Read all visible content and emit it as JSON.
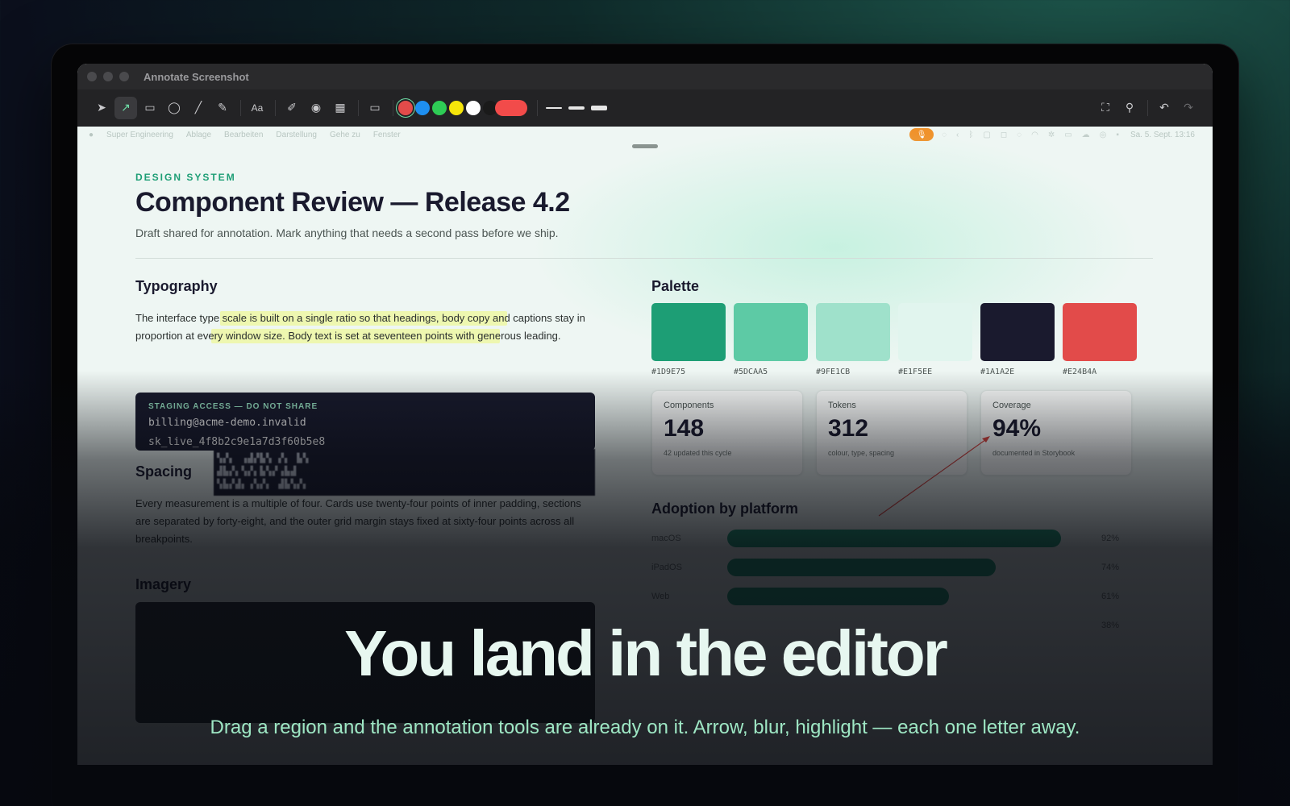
{
  "window": {
    "title": "Annotate Screenshot"
  },
  "toolbar": {
    "tools": [
      {
        "name": "select-tool",
        "glyph": "➤"
      },
      {
        "name": "arrow-tool",
        "glyph": "↗",
        "active": true
      },
      {
        "name": "rectangle-tool",
        "glyph": "▭"
      },
      {
        "name": "ellipse-tool",
        "glyph": "◯"
      },
      {
        "name": "line-tool",
        "glyph": "╱"
      },
      {
        "name": "freehand-tool",
        "glyph": "✎"
      },
      {
        "name": "text-tool",
        "glyph": "Aa"
      },
      {
        "name": "highlighter-tool",
        "glyph": "🖍"
      },
      {
        "name": "blur-tool",
        "glyph": "◉"
      },
      {
        "name": "pixelate-tool",
        "glyph": "▦"
      },
      {
        "name": "redact-tool",
        "glyph": "▬"
      }
    ],
    "colors": [
      "#E24B4A",
      "#1E8FF0",
      "#2ECC55",
      "#F5E50A",
      "#FFFFFF",
      "#1A1A1A"
    ],
    "selected_color": "#E24B4A",
    "active_color_pill": "#F24B4A"
  },
  "menubar": {
    "items": [
      "Super Engineering",
      "Ablage",
      "Bearbeiten",
      "Darstellung",
      "Gehe zu",
      "Fenster"
    ],
    "clock": "Sa. 5. Sept. 13:16"
  },
  "doc": {
    "eyebrow": "DESIGN SYSTEM",
    "title": "Component Review — Release 4.2",
    "subtitle": "Draft shared for annotation. Mark anything that needs a second pass before we ship.",
    "typography": {
      "heading": "Typography",
      "line1": "The interface type scale is built on a single ratio so that headings, body copy and captions stay in",
      "line2": "proportion at every window size. Body text is set at seventeen points with generous leading."
    },
    "secret": {
      "label": "STAGING ACCESS — DO NOT SHARE",
      "email": "billing@acme-demo.invalid",
      "key": "sk_live_4f8b2c9e1a7d3f60b5e8"
    },
    "pixelated_lines": [
      "▚▞▖ ▗▟▞▙▚ ▞▖ ▙▚",
      "▟▙▞▖▚▞▖▙▚▞▗▙▟",
      "▚▙▞▟▖▗▚▞▖ ▟▙▚▞▖"
    ],
    "spacing": {
      "heading": "Spacing",
      "line1": "Every measurement is a multiple of four. Cards use twenty-four points of inner padding, sections",
      "line2": "are separated by forty-eight, and the outer grid margin stays fixed at sixty-four points across all",
      "line3": "breakpoints."
    },
    "imagery": {
      "heading": "Imagery"
    },
    "palette": {
      "heading": "Palette",
      "swatches": [
        {
          "hex": "#1D9E75"
        },
        {
          "hex": "#5DCAA5"
        },
        {
          "hex": "#9FE1CB"
        },
        {
          "hex": "#E1F5EE"
        },
        {
          "hex": "#1A1A2E"
        },
        {
          "hex": "#E24B4A"
        }
      ]
    },
    "stats": [
      {
        "label": "Components",
        "value": "148",
        "note": "42 updated this cycle"
      },
      {
        "label": "Tokens",
        "value": "312",
        "note": "colour, type, spacing"
      },
      {
        "label": "Coverage",
        "value": "94%",
        "note": "documented in Storybook"
      }
    ],
    "adoption": {
      "heading": "Adoption by platform",
      "rows": [
        {
          "platform": "macOS",
          "value": 92,
          "label": "92%"
        },
        {
          "platform": "iPadOS",
          "value": 74,
          "label": "74%"
        },
        {
          "platform": "Web",
          "value": 61,
          "label": "61%"
        },
        {
          "platform": "",
          "value": 0,
          "label": "38%"
        }
      ]
    }
  },
  "overlay": {
    "headline": "You land in the editor",
    "subline": "Drag a region and the annotation tools are already on it. Arrow, blur, highlight — each one letter away."
  },
  "colors": {
    "accent": "#1D9E75",
    "annotation_arrow": "#D9443F",
    "highlight": "#EEF878"
  }
}
